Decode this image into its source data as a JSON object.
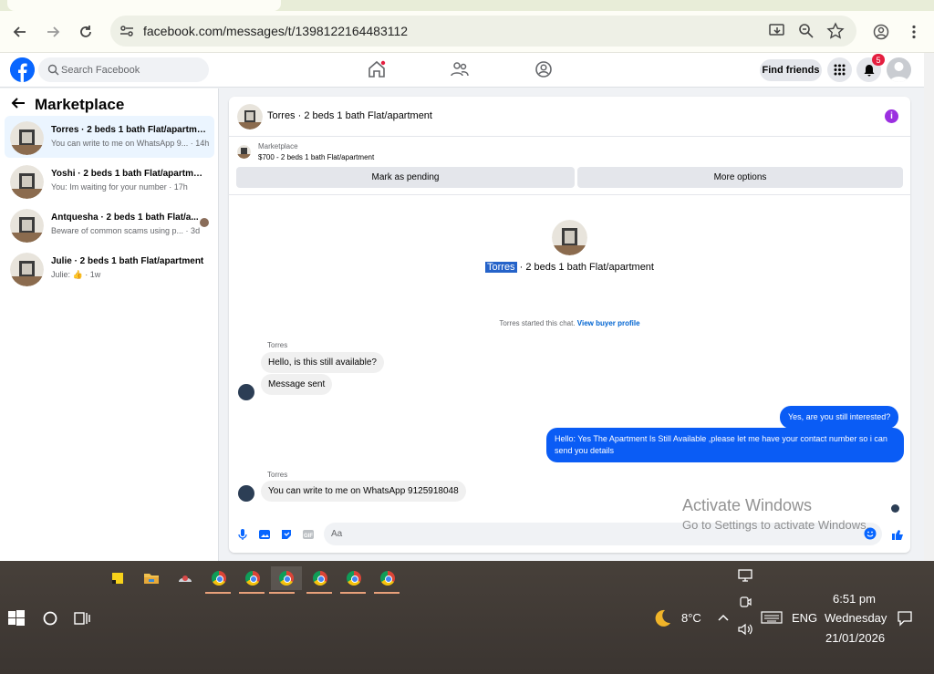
{
  "browser": {
    "url": "facebook.com/messages/t/1398122164483112"
  },
  "fb_header": {
    "search_placeholder": "Search Facebook",
    "find_friends": "Find friends",
    "notification_count": "5"
  },
  "sidebar": {
    "title": "Marketplace",
    "conversations": [
      {
        "name": "Torres · 2 beds 1 bath Flat/apartme...",
        "preview": "You can write to me on WhatsApp 9... · 14h"
      },
      {
        "name": "Yoshi · 2 beds 1 bath Flat/apartment",
        "preview": "You: Im waiting for your number · 17h"
      },
      {
        "name": "Antquesha · 2 beds 1 bath Flat/a...",
        "preview": "Beware of common scams using p... · 3d"
      },
      {
        "name": "Julie · 2 beds 1 bath Flat/apartment",
        "preview": "Julie: 👍 · 1w"
      }
    ]
  },
  "chat": {
    "header_title": "Torres · 2 beds 1 bath Flat/apartment",
    "marketplace_label": "Marketplace",
    "listing": "$700 - 2 beds 1 bath Flat/apartment",
    "mark_pending": "Mark as pending",
    "more_options": "More options",
    "center_name": "Torres",
    "center_rest": " · 2 beds 1 bath Flat/apartment",
    "started_text": "Torres started this chat. ",
    "view_profile": "View buyer profile",
    "messages": {
      "sender1": "Torres",
      "in1": "Hello, is this still available?",
      "in2": "Message sent",
      "out1": "Yes, are you still interested?",
      "out2": "Hello: Yes The Apartment Is Still Available ,please let me have your contact number so i can send you details",
      "sender2": "Torres",
      "in3": "You can write to me on WhatsApp 9125918048"
    },
    "composer_placeholder": "Aa"
  },
  "watermark": {
    "line1": "Activate Windows",
    "line2": "Go to Settings to activate Windows."
  },
  "taskbar": {
    "weather": "8°C",
    "language": "ENG",
    "time": "6:51 pm",
    "day": "Wednesday",
    "date": "21/01/2026"
  },
  "colors": {
    "fb_blue": "#0866ff",
    "out_bubble": "#0a5cf5",
    "badge_red": "#e41e3f",
    "info_purple": "#9b2fe0"
  }
}
